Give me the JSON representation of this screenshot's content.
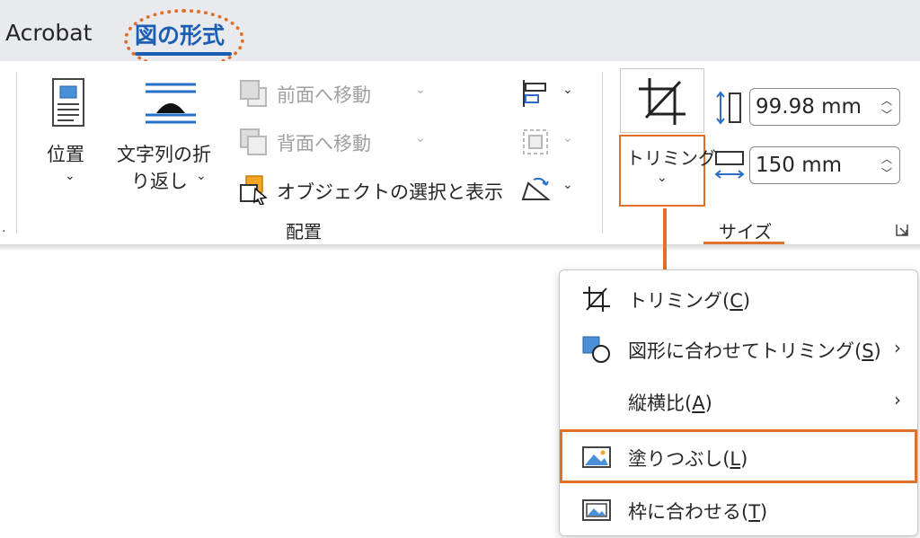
{
  "tabs": {
    "acrobat": "Acrobat",
    "active": "図の形式"
  },
  "arrange": {
    "position_label": "位置",
    "wrap_label_1": "文字列の折",
    "wrap_label_2": "り返し",
    "bring_forward": "前面へ移動",
    "send_backward": "背面へ移動",
    "selection_pane": "オブジェクトの選択と表示",
    "group_label": "配置"
  },
  "size": {
    "crop_label": "トリミング",
    "height_value": "99.98 mm",
    "width_value": "150 mm",
    "group_label": "サイズ"
  },
  "crop_menu": {
    "items": [
      {
        "label": "トリミング(",
        "key": "C",
        "end": ")"
      },
      {
        "label": "図形に合わせてトリミング(",
        "key": "S",
        "end": ")"
      },
      {
        "label": "縦横比(",
        "key": "A",
        "end": ")"
      },
      {
        "label": "塗りつぶし(",
        "key": "L",
        "end": ")"
      },
      {
        "label": "枠に合わせる(",
        "key": "T",
        "end": ")"
      }
    ]
  },
  "colors": {
    "accent": "#1a5fb4",
    "highlight": "#e0702a"
  },
  "icons": [
    "position-icon",
    "wrap-text-icon",
    "bring-forward-icon",
    "send-backward-icon",
    "selection-pane-icon",
    "align-icon",
    "group-icon",
    "rotate-icon",
    "crop-icon",
    "height-icon",
    "width-icon",
    "dialog-launcher-icon",
    "crop-to-shape-icon",
    "fill-icon",
    "fit-icon"
  ]
}
